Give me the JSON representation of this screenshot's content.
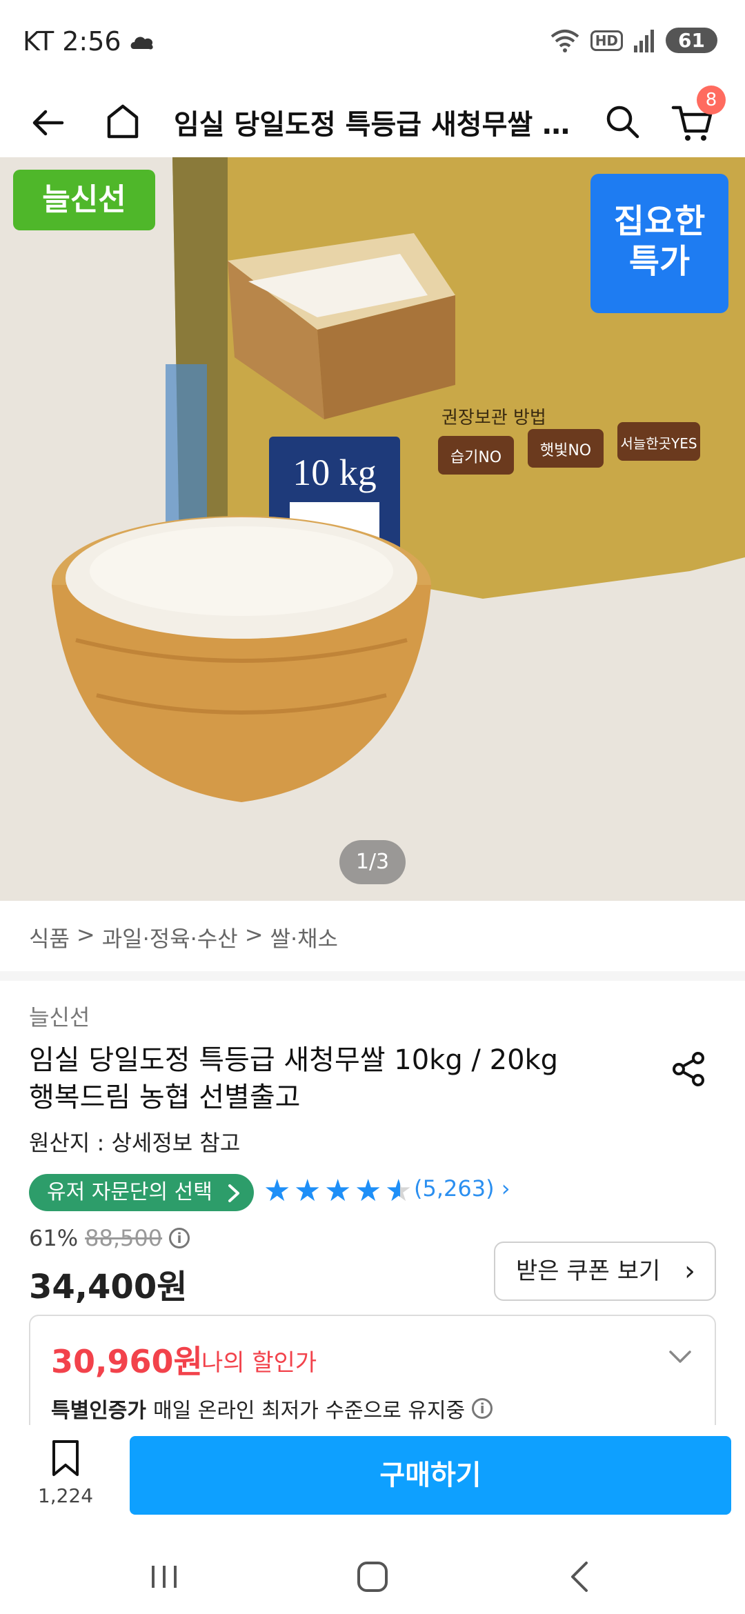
{
  "status_bar": {
    "carrier_time": "KT 2:56",
    "network": "5",
    "hd": "HD",
    "battery": "61"
  },
  "nav": {
    "title": "임실 당일도정 특등급 새청무쌀 10kg / 20kg 행복드림 농협 선별출고",
    "cart_count": "8"
  },
  "image": {
    "tag_fresh": "늘신선",
    "tag_special_line1": "집요한",
    "tag_special_line2": "특가",
    "bag_weight": "10 kg",
    "bag_storage_title": "권장보관 방법",
    "bag_badges": [
      "습기NO",
      "햇빛NO",
      "서늘한곳YES"
    ],
    "page_indicator": "1/3"
  },
  "breadcrumb": [
    "식품",
    ">",
    "과일·정육·수산",
    ">",
    "쌀·채소"
  ],
  "product": {
    "seller": "늘신선",
    "name_line1": "임실 당일도정 특등급 새청무쌀 10kg / 20kg",
    "name_line2": "행복드림 농협 선별출고",
    "origin": "원산지 : 상세정보 참고",
    "choice_badge": "유저 자문단의 선택",
    "rating": 4.5,
    "review_count": "(5,263)",
    "discount_rate": "61%",
    "original_price": "88,500",
    "sale_price": "34,400원",
    "coupon_button": "받은 쿠폰 보기"
  },
  "my_price": {
    "price": "30,960원",
    "label": "나의 할인가",
    "certified_bold": "특별인증가",
    "certified_text": "매일 온라인 최저가 수준으로 유지중"
  },
  "bottom_bar": {
    "bookmark_count": "1,224",
    "buy_label": "구매하기"
  },
  "colors": {
    "accent_blue": "#0ea0ff",
    "fresh_green": "#4fb72a",
    "choice_green": "#2d9d6a",
    "price_red": "#f2424b",
    "special_blue": "#1e7cf2"
  }
}
